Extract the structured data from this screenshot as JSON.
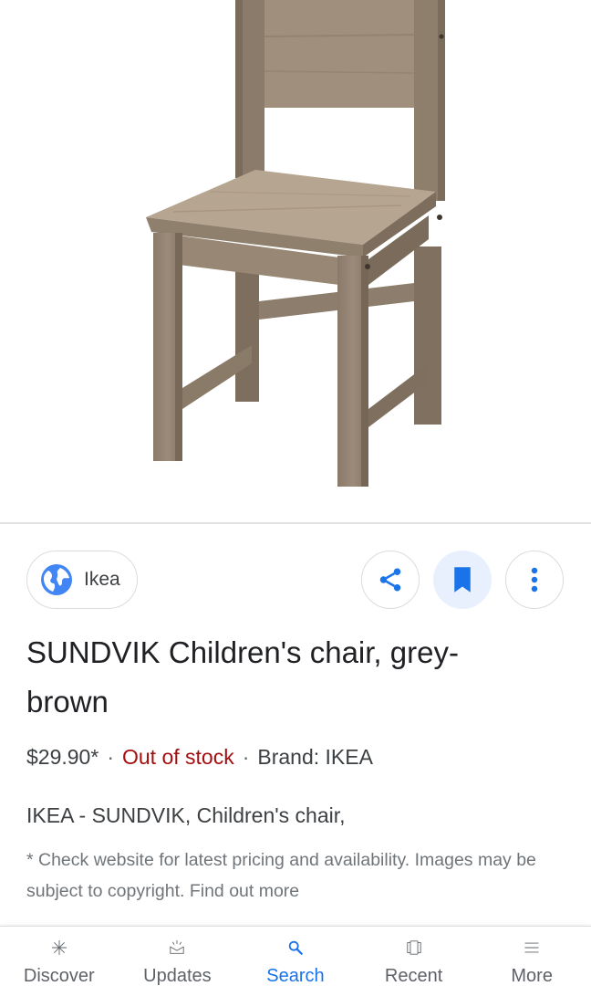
{
  "product_image": {
    "alt": "SUNDVIK Children's chair, grey-brown"
  },
  "source": {
    "label": "Ikea",
    "icon": "globe-icon"
  },
  "actions": {
    "share_icon": "share-icon",
    "save_icon": "bookmark-icon",
    "more_icon": "more-vert-icon"
  },
  "product": {
    "title": "SUNDVIK Children's chair, grey-brown",
    "price": "$29.90*",
    "separator": "·",
    "stock": "Out of stock",
    "brand": "Brand: IKEA",
    "description": "IKEA - SUNDVIK, Children's chair,",
    "disclaimer": "* Check website for latest pricing and availability. Images may be subject to copyright. Find out more"
  },
  "nav": {
    "items": [
      {
        "label": "Discover",
        "icon": "asterisk-icon"
      },
      {
        "label": "Updates",
        "icon": "inbox-icon"
      },
      {
        "label": "Search",
        "icon": "search-icon"
      },
      {
        "label": "Recent",
        "icon": "recent-cards-icon"
      },
      {
        "label": "More",
        "icon": "menu-icon"
      }
    ],
    "active": "Search"
  },
  "colors": {
    "accent": "#1a73e8",
    "out_of_stock": "#a50e0e",
    "save_bg": "#e8f0fe"
  }
}
